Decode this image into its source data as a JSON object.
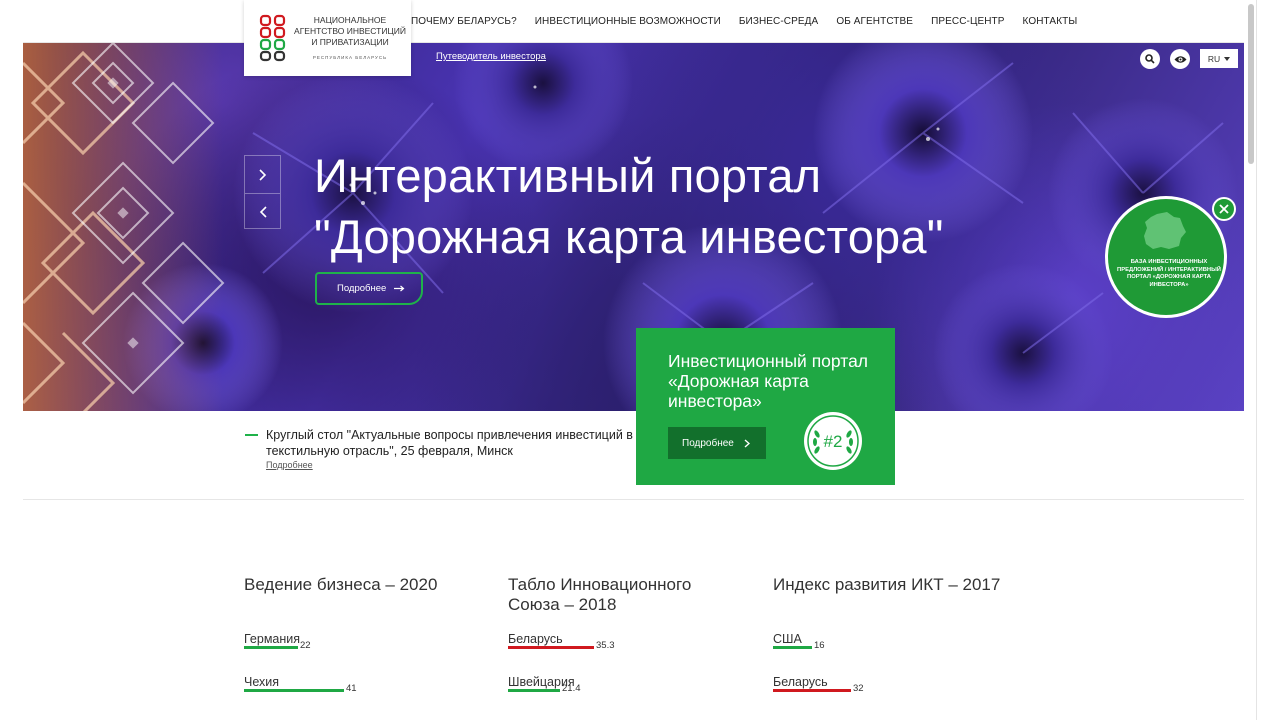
{
  "nav": {
    "items": [
      "ПОЧЕМУ БЕЛАРУСЬ?",
      "ИНВЕСТИЦИОННЫЕ ВОЗМОЖНОСТИ",
      "БИЗНЕС-СРЕДА",
      "ОБ АГЕНТСТВЕ",
      "ПРЕСС-ЦЕНТР",
      "КОНТАКТЫ"
    ]
  },
  "logo": {
    "line1": "НАЦИОНАЛЬНОЕ",
    "line2": "АГЕНТСТВО ИНВЕСТИЦИЙ",
    "line3": "И ПРИВАТИЗАЦИИ",
    "subtitle": "РЕСПУБЛИКА БЕЛАРУСЬ"
  },
  "hero": {
    "guide_link": "Путеводитель инвестора",
    "language": "RU",
    "title_line1": "Интерактивный портал",
    "title_line2": "\"Дорожная карта инвестора\"",
    "more_label": "Подробнее"
  },
  "badge": {
    "text": "БАЗА ИНВЕСТИЦИОННЫХ ПРЕДЛОЖЕНИЙ / ИНТЕРАКТИВНЫЙ ПОРТАЛ «ДОРОЖНАЯ КАРТА ИНВЕСТОРА»"
  },
  "news": {
    "text": "Круглый стол \"Актуальные вопросы привлечения инвестиций в текстильную отрасль\", 25 февраля, Минск",
    "link": "Подробнее"
  },
  "promo": {
    "title": "Инвестиционный портал «Дорожная карта инвестора»",
    "button": "Подробнее",
    "seal_number": "#2"
  },
  "colors": {
    "accent_green": "#1fb24a",
    "bar_green": "#1fa844",
    "bar_red": "#d0191f"
  },
  "indicators": [
    {
      "title": "Ведение бизнеса – 2020",
      "rows": [
        {
          "country": "Германия",
          "value": "22",
          "color": "green",
          "fraction": 0.22
        },
        {
          "country": "Чехия",
          "value": "41",
          "color": "green",
          "fraction": 0.41
        }
      ]
    },
    {
      "title": "Табло Инновационного Союза – 2018",
      "rows": [
        {
          "country": "Беларусь",
          "value": "35.3",
          "color": "red",
          "fraction": 0.353
        },
        {
          "country": "Швейцария",
          "value": "21.4",
          "color": "green",
          "fraction": 0.214
        }
      ]
    },
    {
      "title": "Индекс развития ИКТ – 2017",
      "rows": [
        {
          "country": "США",
          "value": "16",
          "color": "green",
          "fraction": 0.16
        },
        {
          "country": "Беларусь",
          "value": "32",
          "color": "red",
          "fraction": 0.32
        }
      ]
    }
  ]
}
